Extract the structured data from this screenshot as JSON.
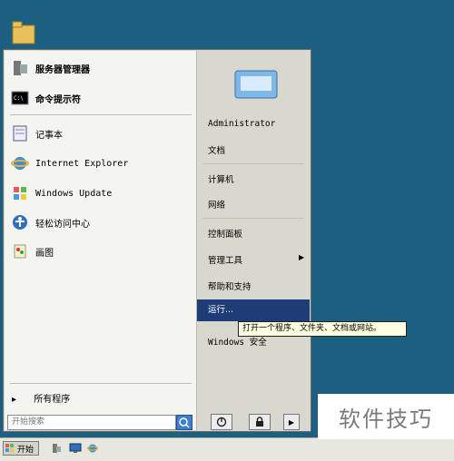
{
  "start_menu": {
    "pinned": [
      {
        "label": "服务器管理器"
      },
      {
        "label": "命令提示符"
      }
    ],
    "recent": [
      {
        "label": "记事本"
      },
      {
        "label": "Internet Explorer"
      },
      {
        "label": "Windows Update"
      },
      {
        "label": "轻松访问中心"
      },
      {
        "label": "画图"
      }
    ],
    "all_programs": "所有程序",
    "search_placeholder": "开始搜索",
    "right": {
      "user": "Administrator",
      "items": [
        "文档",
        "计算机",
        "网络",
        "控制面板",
        "管理工具",
        "帮助和支持",
        "运行...",
        "Windows 安全"
      ]
    }
  },
  "tooltip": "打开一个程序、文件夹、文档或网站。",
  "taskbar": {
    "start_label": "开始"
  },
  "watermark": "软件技巧",
  "colors": {
    "desktop": "#1d5f80",
    "highlight": "#1e3d78"
  }
}
